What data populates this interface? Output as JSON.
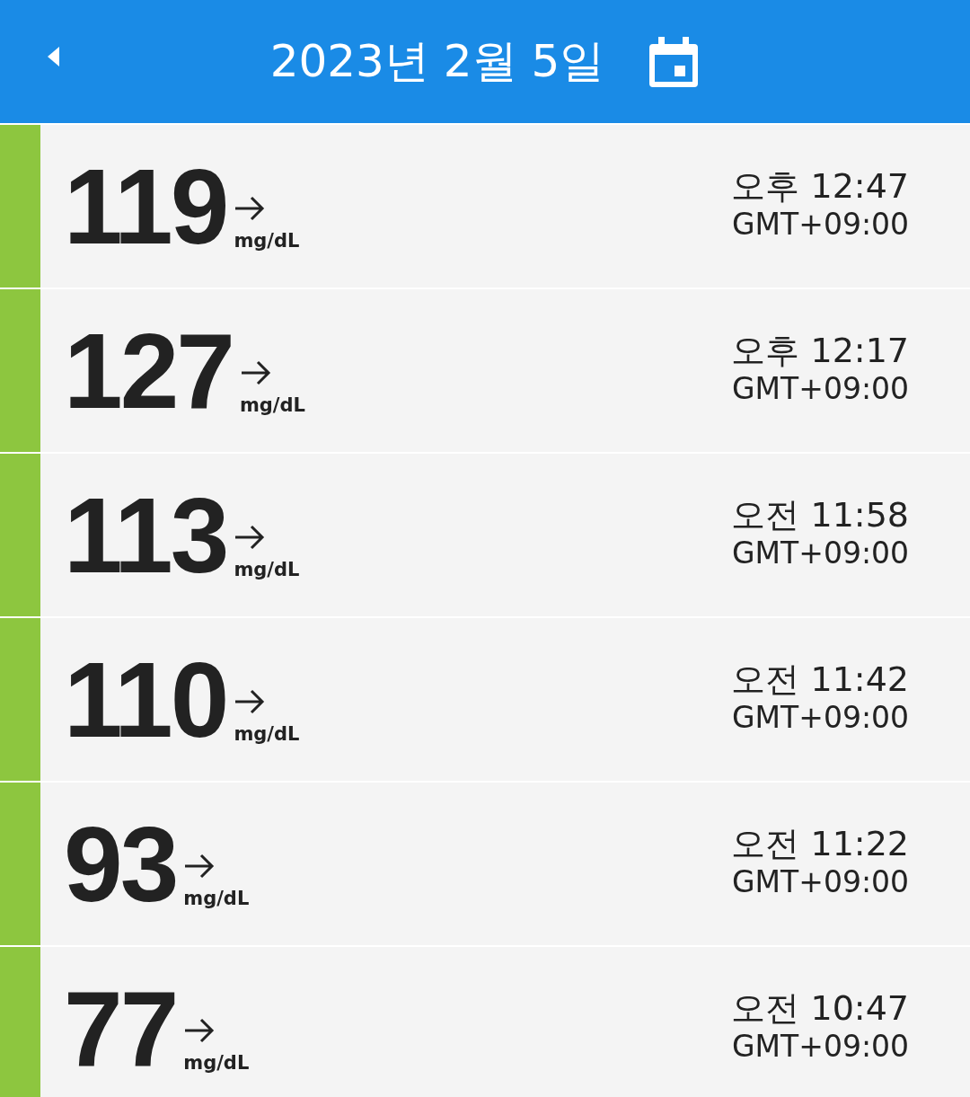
{
  "header": {
    "title": "2023년 2월 5일"
  },
  "readings": [
    {
      "value": "119",
      "unit": "mg/dL",
      "time": "오후 12:47",
      "timezone": "GMT+09:00",
      "color": "#8dc63f"
    },
    {
      "value": "127",
      "unit": "mg/dL",
      "time": "오후 12:17",
      "timezone": "GMT+09:00",
      "color": "#8dc63f"
    },
    {
      "value": "113",
      "unit": "mg/dL",
      "time": "오전 11:58",
      "timezone": "GMT+09:00",
      "color": "#8dc63f"
    },
    {
      "value": "110",
      "unit": "mg/dL",
      "time": "오전 11:42",
      "timezone": "GMT+09:00",
      "color": "#8dc63f"
    },
    {
      "value": "93",
      "unit": "mg/dL",
      "time": "오전 11:22",
      "timezone": "GMT+09:00",
      "color": "#8dc63f"
    },
    {
      "value": "77",
      "unit": "mg/dL",
      "time": "오전 10:47",
      "timezone": "GMT+09:00",
      "color": "#8dc63f"
    }
  ]
}
